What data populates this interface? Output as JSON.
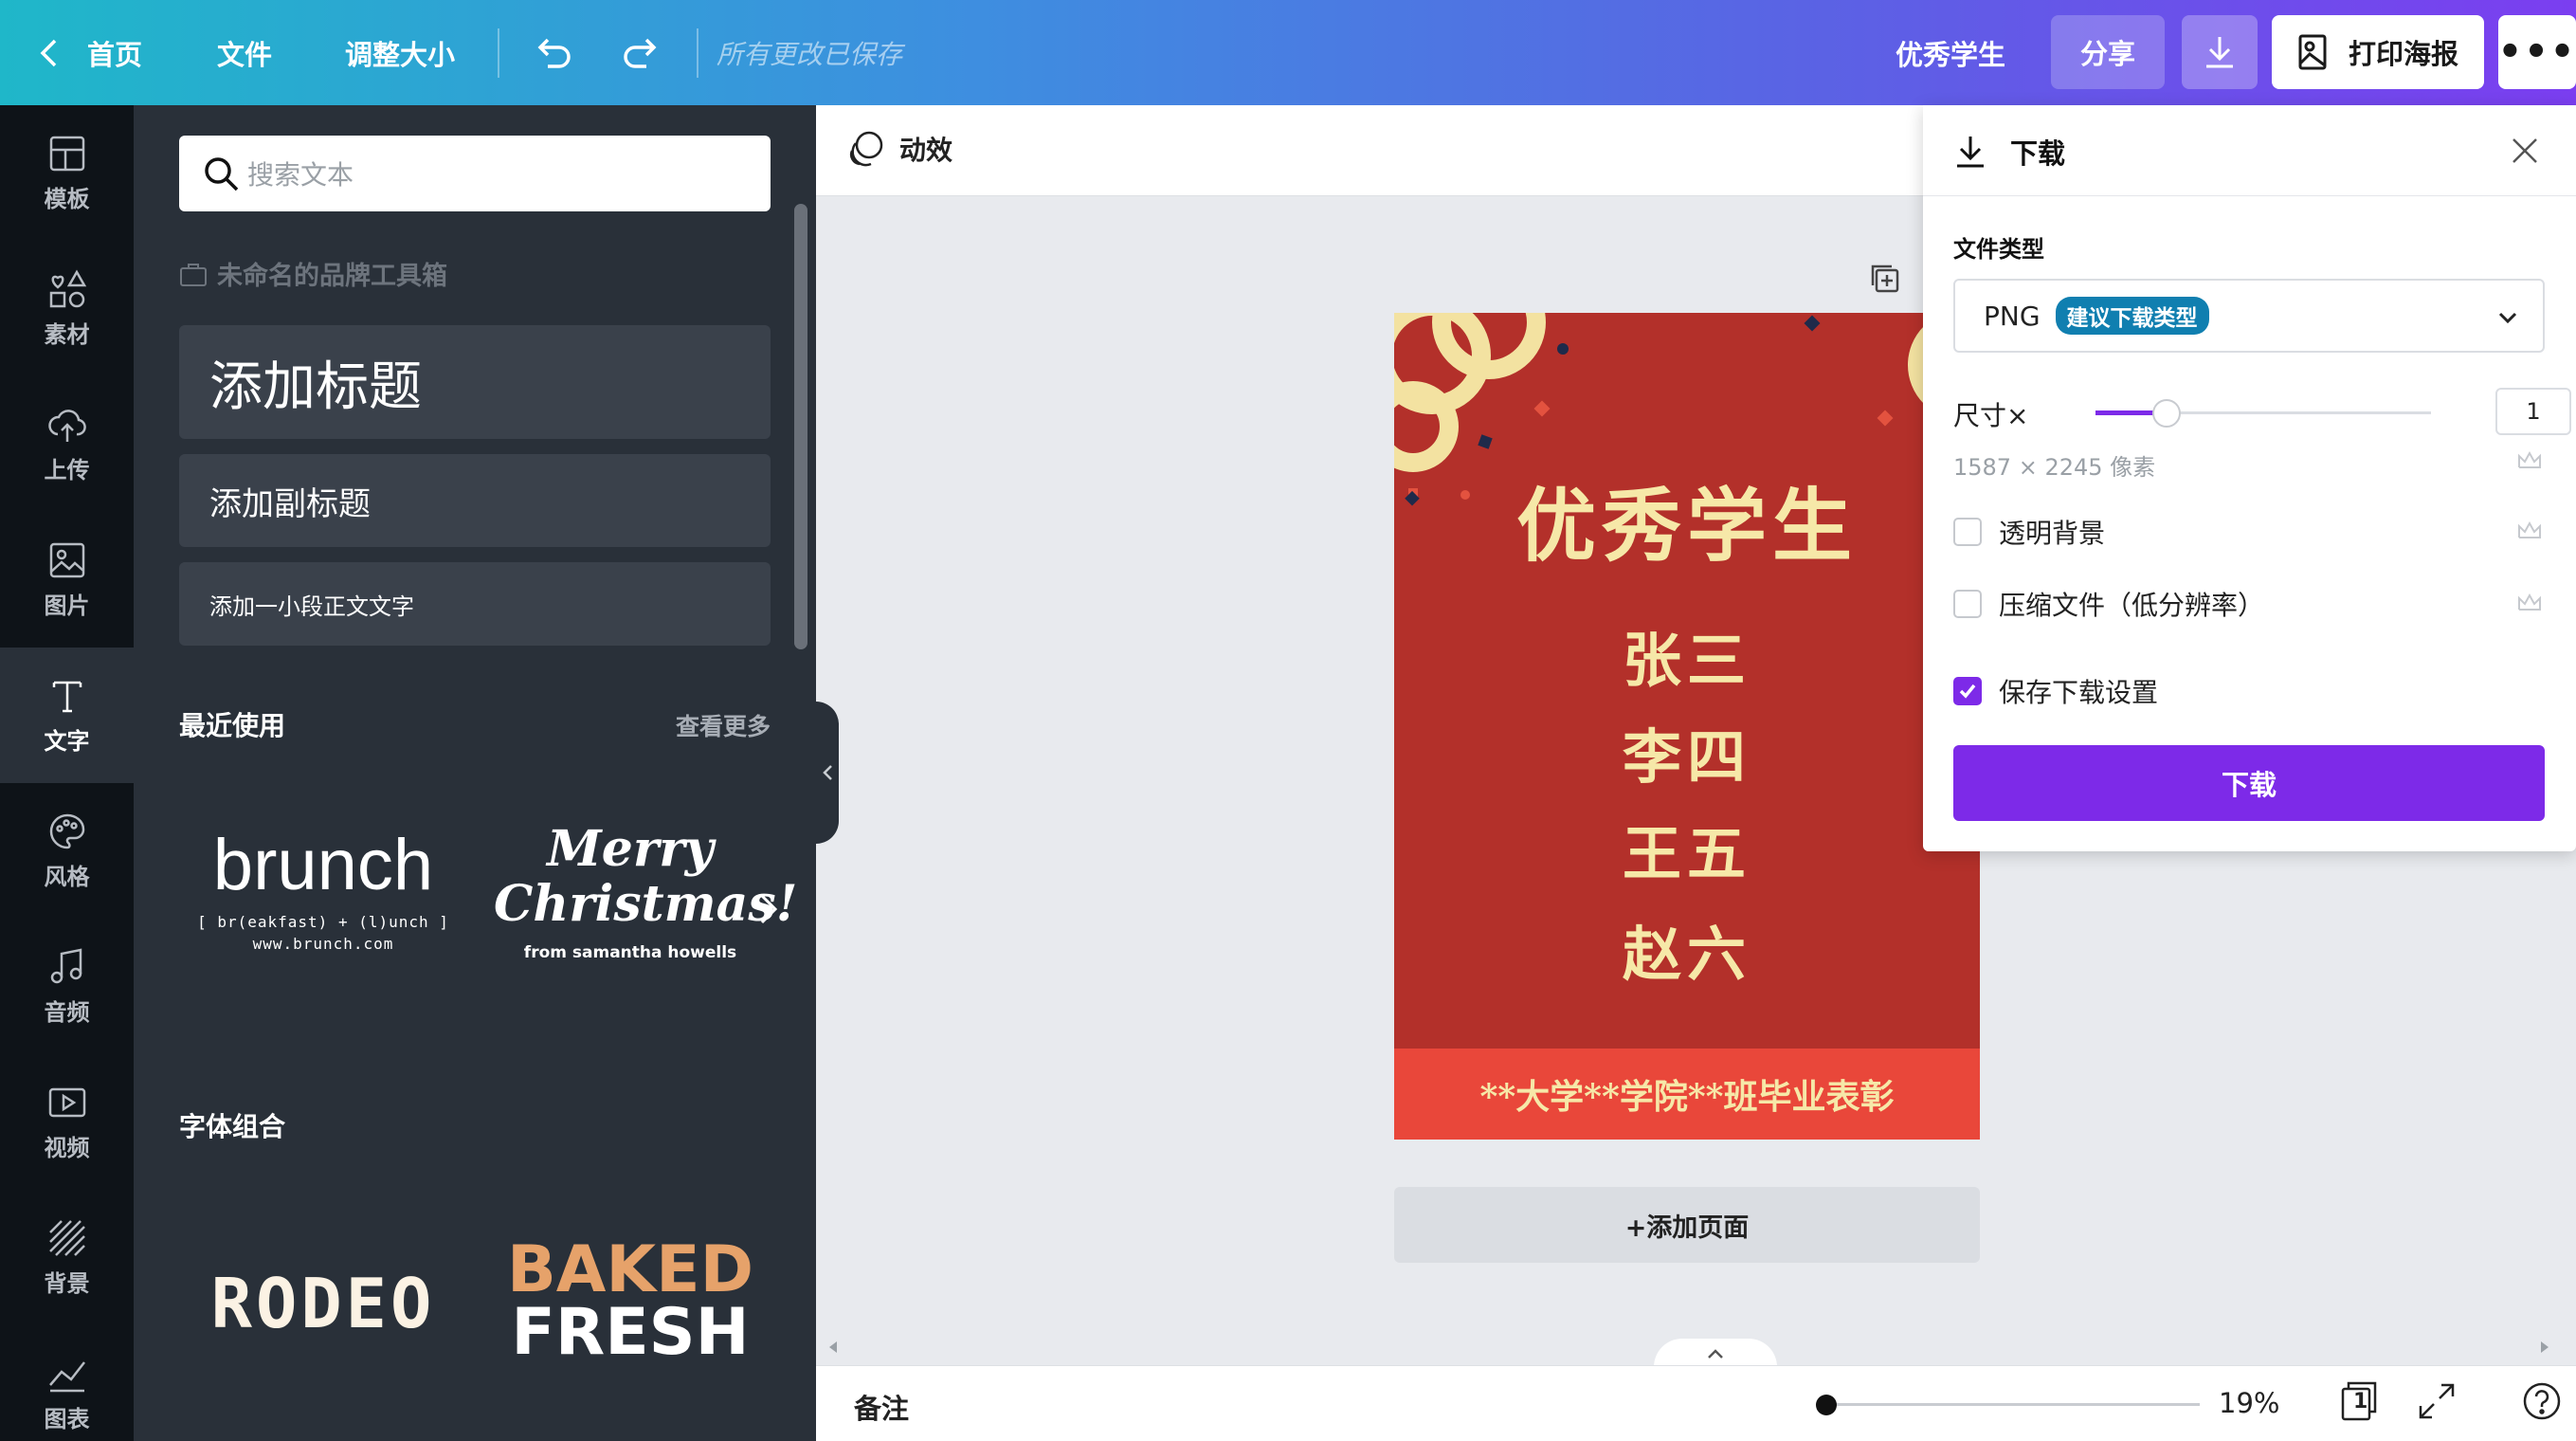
{
  "topbar": {
    "home": "首页",
    "file": "文件",
    "resize": "调整大小",
    "saved_status": "所有更改已保存",
    "doc_title": "优秀学生",
    "share": "分享",
    "print": "打印海报",
    "more": "•••",
    "gradient": [
      "#1fb7c9",
      "#3e8ee0",
      "#5a63e4",
      "#7b3ef0"
    ]
  },
  "rail": {
    "items": [
      {
        "label": "模板",
        "icon": "layout-icon"
      },
      {
        "label": "素材",
        "icon": "elements-icon"
      },
      {
        "label": "上传",
        "icon": "upload-cloud-icon"
      },
      {
        "label": "图片",
        "icon": "image-icon"
      },
      {
        "label": "文字",
        "icon": "text-icon"
      },
      {
        "label": "风格",
        "icon": "palette-icon"
      },
      {
        "label": "音频",
        "icon": "music-icon"
      },
      {
        "label": "视频",
        "icon": "video-icon"
      },
      {
        "label": "背景",
        "icon": "background-icon"
      },
      {
        "label": "图表",
        "icon": "chart-icon"
      }
    ],
    "active": "文字"
  },
  "panel": {
    "search_placeholder": "搜索文本",
    "brand_kit": "未命名的品牌工具箱",
    "add_heading": "添加标题",
    "add_subheading": "添加副标题",
    "add_body": "添加一小段正文文字",
    "recent_title": "最近使用",
    "see_more": "查看更多",
    "combos_title": "字体组合",
    "recent": [
      {
        "main": "brunch",
        "sub1": "[ br(eakfast) + (l)unch ]",
        "sub2": "www.brunch.com"
      },
      {
        "main1": "Merry",
        "main2": "Christmas!",
        "sub": "from samantha howells"
      }
    ],
    "combos": [
      {
        "main": "RODEO"
      },
      {
        "line1": "BAKED",
        "line2": "FRESH"
      }
    ]
  },
  "editbar": {
    "animate": "动效"
  },
  "poster": {
    "title": "优秀学生",
    "names": [
      "张三",
      "李四",
      "王五",
      "赵六"
    ],
    "footer": "**大学**学院**班毕业表彰",
    "colors": {
      "bg": "#b3302a",
      "text": "#f6e8a8",
      "footer_bg": "#e9473a"
    }
  },
  "add_page": "+添加页面",
  "footer": {
    "notes": "备注",
    "zoom": "19%",
    "page_count": "1"
  },
  "download": {
    "title": "下载",
    "file_type_label": "文件类型",
    "file_type": "PNG",
    "recommended_badge": "建议下载类型",
    "size_label": "尺寸×",
    "size_value": "1",
    "size_fraction": 0.14,
    "dimensions": "1587 × 2245 像素",
    "options": [
      {
        "label": "透明背景",
        "checked": false
      },
      {
        "label": "压缩文件（低分辨率）",
        "checked": false
      },
      {
        "label": "保存下载设置",
        "checked": true
      }
    ],
    "button": "下载",
    "accent": "#7d2ae8"
  }
}
